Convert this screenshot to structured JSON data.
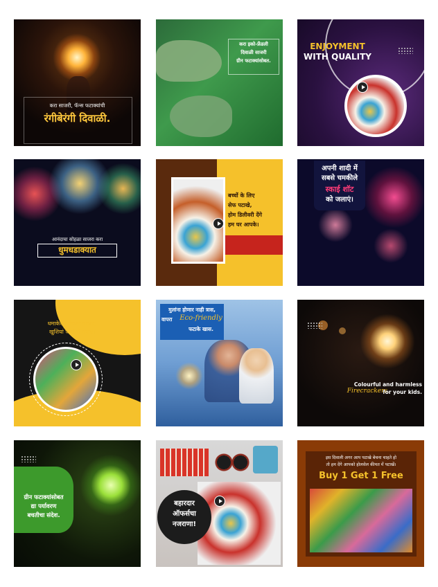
{
  "tiles": {
    "t1": {
      "line1": "करा साजरी, फॅन्स फटाक्यांची",
      "line2": "रंगीबेरंगी दिवाळी."
    },
    "t2": {
      "line1": "करा इको-फ्रेंडली",
      "line2": "दिवाळी साजरी",
      "line3": "ग्रीन फटाक्यांसोबत."
    },
    "t3": {
      "line1": "ENJOYMENT",
      "line2": "WITH QUALITY"
    },
    "t4": {
      "line1": "आनंदाचा सोहळा साजरा करा",
      "line2": "धुमधडाक्यात"
    },
    "t5": {
      "line1": "बच्चों के लिए",
      "line2": "सेफ पटाखे,",
      "line3": "होम डिलीवरी देंगे",
      "line4": "हम घर आपके।"
    },
    "t6": {
      "line1": "अपनी शादी में",
      "line2": "सबसे चमकीले",
      "line3": "स्काई शॉट",
      "line4": "को जलाएं।"
    },
    "t7": {
      "line1": "धमाकेदार क्रैकर्स जलाए,",
      "line2": "खुशियां जोरों से मनाए।"
    },
    "t8": {
      "line1": "मुलांना होणार नाही त्रास,",
      "line2": "वापरा",
      "line3": "Eco-friendly",
      "line4": "फटाके खास."
    },
    "t9": {
      "line1": "Colourful and harmless",
      "line2": "Firecrackers",
      "line3": "for your kids."
    },
    "t10": {
      "line1": "ग्रीन फटाक्यांसोबत",
      "line2": "द्या पर्यावरण",
      "line3": "बचतीचा संदेश."
    },
    "t11": {
      "line1": "बहारदार",
      "line2": "ऑफर्सचा",
      "line3": "नजराणा!"
    },
    "t12": {
      "line1": "इस दिवाली अगर आप पटाखे बेचना चाहते हो",
      "line2": "तो हम देंगे आपको होलसेल कीमत में पटाखें।",
      "line3": "Buy 1 Get 1 Free"
    }
  },
  "colors": {
    "gold": "#f5c12b",
    "red": "#d7261f",
    "navy": "#1d1f4a",
    "green": "#2e8c37"
  }
}
